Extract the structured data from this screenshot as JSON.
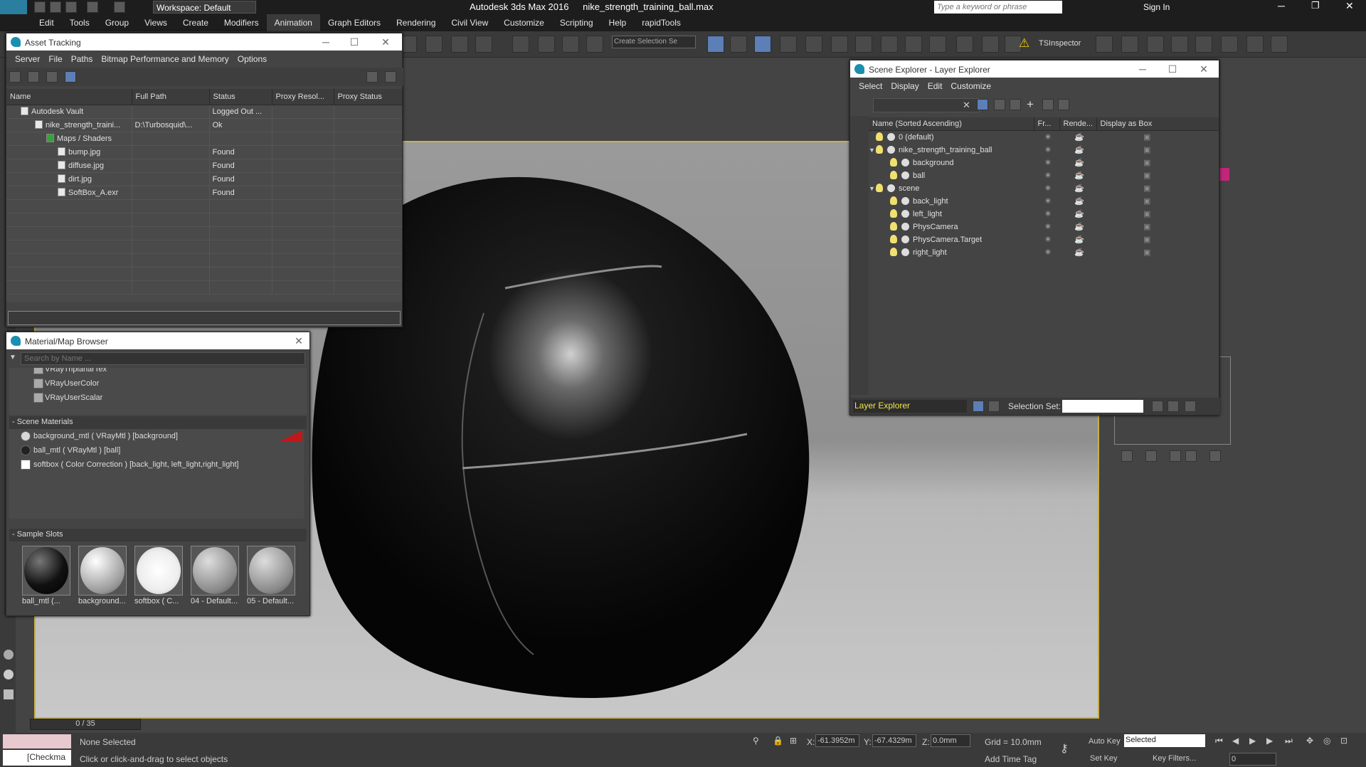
{
  "titlebar": {
    "app_title": "Autodesk 3ds Max 2016",
    "file_name": "nike_strength_training_ball.max",
    "workspace": "Workspace: Default",
    "search_placeholder": "Type a keyword or phrase",
    "sign_in": "Sign In"
  },
  "menubar": [
    "Edit",
    "Tools",
    "Group",
    "Views",
    "Create",
    "Modifiers",
    "Animation",
    "Graph Editors",
    "Rendering",
    "Civil View",
    "Customize",
    "Scripting",
    "Help",
    "rapidTools"
  ],
  "toolbar": {
    "selection_set": "Create Selection Se",
    "ts_inspector": "TSInspector"
  },
  "asset_tracking": {
    "title": "Asset Tracking",
    "menu": [
      "Server",
      "File",
      "Paths",
      "Bitmap Performance and Memory",
      "Options"
    ],
    "columns": [
      "Name",
      "Full Path",
      "Status",
      "Proxy Resol...",
      "Proxy Status"
    ],
    "rows": [
      {
        "name": "Autodesk Vault",
        "path": "",
        "status": "Logged Out ..."
      },
      {
        "name": "nike_strength_traini...",
        "path": "D:\\Turbosquid\\...",
        "status": "Ok"
      },
      {
        "name": "Maps / Shaders",
        "path": "",
        "status": ""
      },
      {
        "name": "bump.jpg",
        "path": "",
        "status": "Found"
      },
      {
        "name": "diffuse.jpg",
        "path": "",
        "status": "Found"
      },
      {
        "name": "dirt.jpg",
        "path": "",
        "status": "Found"
      },
      {
        "name": "SoftBox_A.exr",
        "path": "",
        "status": "Found"
      }
    ]
  },
  "material_browser": {
    "title": "Material/Map Browser",
    "search_placeholder": "Search by Name ...",
    "top_items": [
      "VRayTriplanarTex",
      "VRayUserColor",
      "VRayUserScalar"
    ],
    "scene_materials_header": "- Scene Materials",
    "scene_materials": [
      "background_mtl  ( VRayMtl ) [background]",
      "ball_mtl  ( VRayMtl ) [ball]",
      "softbox ( Color Correction ) [back_light, left_light,right_light]"
    ],
    "sample_slots_header": "- Sample Slots",
    "sample_slots": [
      "ball_mtl  (...",
      "background...",
      "softbox ( C...",
      "04 - Default...",
      "05 - Default..."
    ]
  },
  "scene_explorer": {
    "title": "Scene Explorer - Layer Explorer",
    "menu": [
      "Select",
      "Display",
      "Edit",
      "Customize"
    ],
    "columns": [
      "Name (Sorted Ascending)",
      "Fr...",
      "Rende...",
      "Display as Box"
    ],
    "rows": [
      {
        "label": "0 (default)",
        "indent": 1
      },
      {
        "label": "nike_strength_training_ball",
        "indent": 1
      },
      {
        "label": "background",
        "indent": 2
      },
      {
        "label": "ball",
        "indent": 2
      },
      {
        "label": "scene",
        "indent": 1
      },
      {
        "label": "back_light",
        "indent": 2
      },
      {
        "label": "left_light",
        "indent": 2
      },
      {
        "label": "PhysCamera",
        "indent": 2
      },
      {
        "label": "PhysCamera.Target",
        "indent": 2
      },
      {
        "label": "right_light",
        "indent": 2
      }
    ],
    "footer_mode": "Layer Explorer",
    "selection_set_label": "Selection Set:"
  },
  "statusbar": {
    "frame_counter": "0 / 35",
    "none_selected": "None Selected",
    "hint": "Click or click-and-drag to select objects",
    "x_label": "X:",
    "x_value": "-61.3952m",
    "y_label": "Y:",
    "y_value": "-67.4329m",
    "z_label": "Z:",
    "z_value": "0.0mm",
    "grid": "Grid = 10.0mm",
    "add_time_tag": "Add Time Tag",
    "auto_key": "Auto Key",
    "set_key": "Set Key",
    "key_mode": "Selected",
    "key_filters": "Key Filters...",
    "frame_field": "0",
    "maxscript": "[Checkma"
  },
  "colors": {
    "accent": "#5b7fb6",
    "viewport_border": "#c9b04a",
    "highlight": "#f4e54a"
  }
}
